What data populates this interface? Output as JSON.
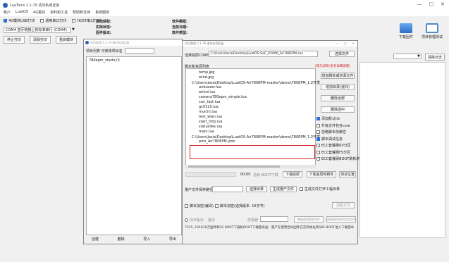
{
  "window": {
    "title": "LuaTools 2.1.79 请勿私用此窗",
    "controls": [
      "—",
      "□",
      "✕"
    ]
  },
  "menu": [
    "帐户",
    "LuatOS",
    "4G模块",
    "资料和工具",
    "帮助和支持",
    "系统服务"
  ],
  "connection": {
    "options": [
      {
        "label": "4G模块USB打印",
        "checked": true
      },
      {
        "label": "通用串口打印",
        "checked": false
      },
      {
        "label": "HOST串口打印",
        "checked": false
      }
    ],
    "port_select": "COM4 蓝牙链接上的标准串行 (COM4)",
    "port_arrow": "▼"
  },
  "left_buttons": [
    "停止打印",
    "清除打印",
    "重启模块"
  ],
  "info": {
    "col1": [
      "自动获取:",
      "实际状态:",
      "固件版本:"
    ],
    "col2": [
      "软件模组:",
      "当前日期:",
      "软件类型:"
    ]
  },
  "tools": {
    "download": "下载固件",
    "settings": "项目管理测试"
  },
  "right_panel": {
    "combo_arrow": "▼",
    "clear_log": "清除日志"
  },
  "project_dialog": {
    "title": "项目管理 2.1.79 请勿私用此窗",
    "list_label": "项目列表 可修改项目名",
    "projects": [
      "780epm_starts13"
    ],
    "buttons": [
      "创建",
      "删除",
      "导入",
      "导出"
    ]
  },
  "main_dialog": {
    "title": "项目管理 2.1.79 请勿私用此窗",
    "controls": [
      "—",
      "□",
      "✕"
    ],
    "core_label": "选择底层CORE",
    "core_path": "C:\\Users\\lasia\\Desktop\\LuatOS-SoC_V2006_Air780EPM.soc",
    "core_button": "选择文件",
    "script_label": "脚本和资源列表",
    "script_warning": "[提示说明:更多详细请看]",
    "file_tree": [
      {
        "text": "temp.jpg",
        "type": "file"
      },
      {
        "text": "wind.jpg",
        "type": "file"
      },
      {
        "text": "C:\\Users\\lasia\\Desktop\\LuatOS-Air780EPM-master\\demo\\780EPM_1.2开发",
        "type": "folder"
      },
      {
        "text": "airbuzzer.lua",
        "type": "file"
      },
      {
        "text": "airlcd.lua",
        "type": "file"
      },
      {
        "text": "camera780epm_simple.lua",
        "type": "file"
      },
      {
        "text": "can_test.lua",
        "type": "file"
      },
      {
        "text": "gc0310.lua",
        "type": "file"
      },
      {
        "text": "mulchi.lua",
        "type": "file"
      },
      {
        "text": "test_wlan.lua",
        "type": "file"
      },
      {
        "text": "start_http.lua",
        "type": "file"
      },
      {
        "text": "statuslike.lua",
        "type": "file"
      },
      {
        "text": "main.lua",
        "type": "file"
      },
      {
        "text": "C:\\Users\\lasia\\Desktop\\LuatOS-Air780EPM-master\\demo\\780EPM_1.2开发",
        "type": "folder"
      },
      {
        "text": "pins_Air780EPM.json",
        "type": "file"
      }
    ],
    "side_buttons": [
      "增加脚本或资源文件",
      "增加目录(递归)",
      "删除全部",
      "删除选中"
    ],
    "options": [
      {
        "label": "添加默认lib",
        "checked": true
      },
      {
        "label": "升级文件包含core",
        "checked": false
      },
      {
        "label": "忽略脚本依赖性",
        "checked": false
      },
      {
        "label": "脚本调试信息",
        "checked": true
      },
      {
        "label": "ECC套餐刷KV分区",
        "checked": false
      },
      {
        "label": "ECC套餐刷FS分区",
        "checked": false
      },
      {
        "label": "ECC套餐刷BOOT刷新坏",
        "checked": false
      }
    ],
    "progress": {
      "time": "00:00",
      "status": "总耗 BOOT下载",
      "percent": 0
    },
    "download_buttons": [
      "下载底层",
      "下载底层和脚本",
      "测试位置"
    ],
    "output_label": "量产文件保存路径",
    "output_buttons": [
      "选择目录",
      "生成量产文件"
    ],
    "output_option": "生成文件打开工程目录",
    "encrypt_label": "脚本加密(编译)",
    "encrypt_option": "脚本加密(选择版本: 16字节)",
    "encrypt_button": "加密文件",
    "extra": {
      "label": "操作备份",
      "sub": "备份",
      "btn1": "部署器",
      "btn2": "数据启用类型文件",
      "btn3": "选择固件启用类型文件"
    },
    "footer": "7315, 101610万固件和SS BOOT下载机BOOT下载使命品：量产在使用合同固件在实际地址和S85 BOOT进入下载使命"
  }
}
